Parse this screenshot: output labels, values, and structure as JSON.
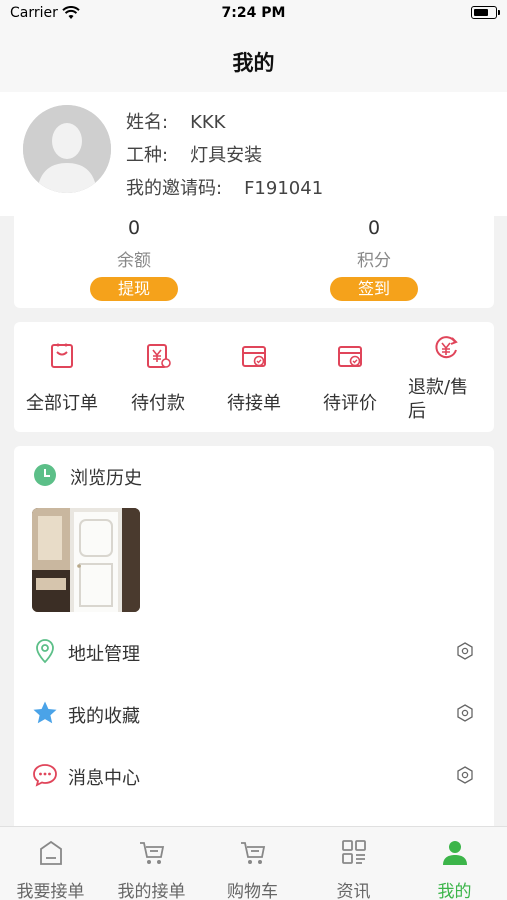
{
  "status_bar": {
    "carrier": "Carrier",
    "time": "7:24 PM"
  },
  "nav": {
    "title": "我的"
  },
  "profile": {
    "name_label": "姓名:",
    "name": "KKK",
    "trade_label": "工种:",
    "trade": "灯具安装",
    "invite_label": "我的邀请码:",
    "invite_code": "F191041"
  },
  "wallet": {
    "balance_value": "0",
    "balance_label": "余额",
    "withdraw_button": "提现",
    "points_value": "0",
    "points_label": "积分",
    "checkin_button": "签到"
  },
  "orders": [
    {
      "label": "全部订单",
      "icon": "all-orders-icon"
    },
    {
      "label": "待付款",
      "icon": "pending-payment-icon"
    },
    {
      "label": "待接单",
      "icon": "pending-accept-icon"
    },
    {
      "label": "待评价",
      "icon": "pending-review-icon"
    },
    {
      "label": "退款/售后",
      "icon": "refund-icon"
    }
  ],
  "history": {
    "title": "浏览历史"
  },
  "menu": [
    {
      "label": "地址管理",
      "icon": "location-icon"
    },
    {
      "label": "我的收藏",
      "icon": "star-icon"
    },
    {
      "label": "消息中心",
      "icon": "message-icon"
    }
  ],
  "tabs": [
    {
      "label": "我要接单",
      "icon": "home-icon"
    },
    {
      "label": "我的接单",
      "icon": "cart-icon"
    },
    {
      "label": "购物车",
      "icon": "shopping-cart-icon"
    },
    {
      "label": "资讯",
      "icon": "news-icon"
    },
    {
      "label": "我的",
      "icon": "person-icon",
      "active": true
    }
  ],
  "colors": {
    "accent_orange": "#f5a21b",
    "active_green": "#3cb54a",
    "icon_red": "#e0455a"
  }
}
